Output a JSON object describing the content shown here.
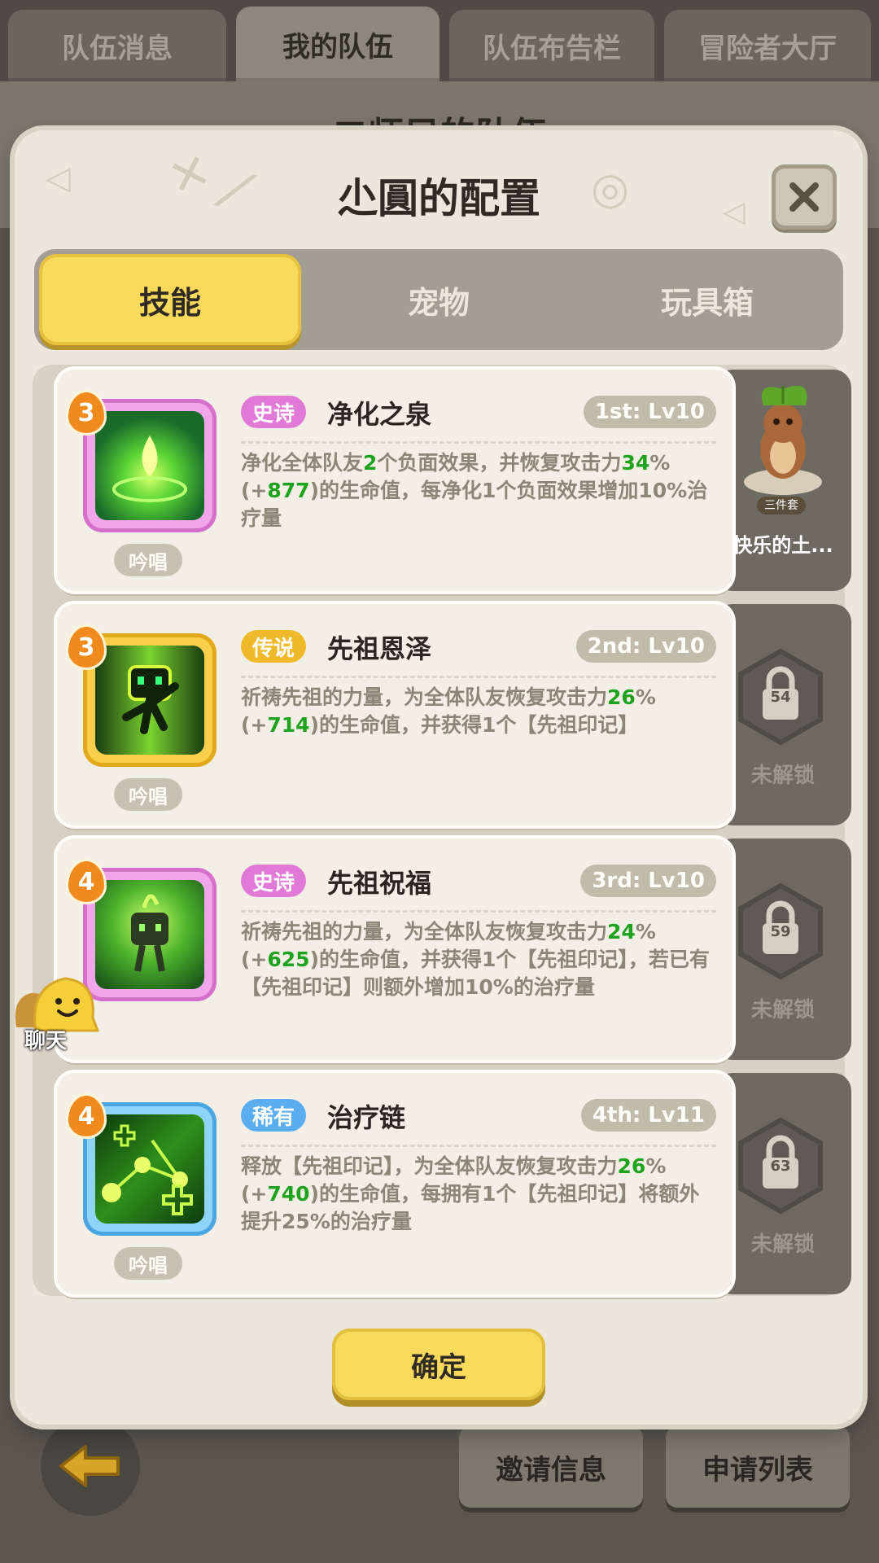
{
  "top_tabs": [
    {
      "label": "队伍消息"
    },
    {
      "label": "我的队伍"
    },
    {
      "label": "队伍布告栏"
    },
    {
      "label": "冒险者大厅"
    }
  ],
  "background": {
    "title": "二师兄的队伍",
    "invite_label": "邀请信息",
    "apply_label": "申请列表"
  },
  "modal": {
    "title": "尐圓的配置",
    "tabs": [
      {
        "label": "技能"
      },
      {
        "label": "宠物"
      },
      {
        "label": "玩具箱"
      }
    ],
    "confirm_label": "确定"
  },
  "skills": [
    {
      "level": "3",
      "rarity": "史诗",
      "name": "净化之泉",
      "slot": "1st: Lv10",
      "desc": [
        "净化全体队友",
        "2",
        "个负面效果，并恢复攻击力",
        "34",
        "%(+",
        "877",
        ")的生命值，每净化1个负面效果增加10%治疗量"
      ],
      "chant": "吟唱"
    },
    {
      "level": "3",
      "rarity": "传说",
      "name": "先祖恩泽",
      "slot": "2nd: Lv10",
      "desc": [
        "祈祷先祖的力量，为全体队友恢复攻击力",
        "26",
        "%(+",
        "714",
        ")的生命值，并获得1个【先祖印记】",
        "",
        ""
      ],
      "chant": "吟唱"
    },
    {
      "level": "4",
      "rarity": "史诗",
      "name": "先祖祝福",
      "slot": "3rd: Lv10",
      "desc": [
        "祈祷先祖的力量，为全体队友恢复攻击力",
        "24",
        "%(+",
        "625",
        ")的生命值，并获得1个【先祖印记】，若已有【先祖印记】则额外增加10%的治疗量",
        "",
        ""
      ],
      "chant": "吟唱"
    },
    {
      "level": "4",
      "rarity": "稀有",
      "name": "治疗链",
      "slot": "4th: Lv11",
      "desc": [
        "释放【先祖印记】，为全体队友恢复攻击力",
        "26",
        "%(+",
        "740",
        ")的生命值，每拥有1个【先祖印记】将额外提升25%的治疗量",
        "",
        ""
      ],
      "chant": "吟唱"
    }
  ],
  "side": {
    "pet_name": "快乐的土...",
    "pet_set": "三件套",
    "locks": [
      {
        "level": "54",
        "label": "未解锁"
      },
      {
        "level": "59",
        "label": "未解锁"
      },
      {
        "level": "63",
        "label": "未解锁"
      }
    ]
  },
  "chat_label": "聊天",
  "colors": {
    "epic": "#e07ad6",
    "legend": "#f0b92a",
    "rare": "#5aaef0",
    "accent_yellow": "#f7d95c",
    "value_green": "#1fa31f"
  }
}
